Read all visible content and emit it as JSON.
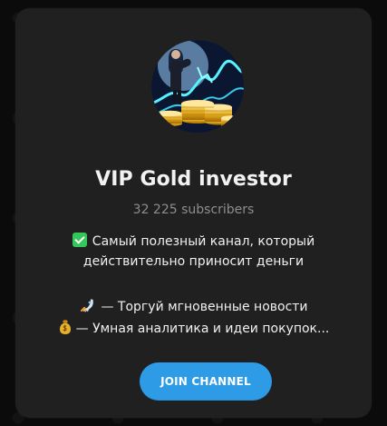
{
  "card": {
    "title": "VIP Gold investor",
    "subscribers": "32 225 subscribers",
    "description": {
      "line1": "Самый полезный канал, который",
      "line2": "действительно приносит деньги",
      "line3": "— Торгуй мгновенные новости",
      "line4": "— Умная аналитика и идеи покупок..."
    },
    "join_button": "JOIN CHANNEL"
  },
  "icons": {
    "check": "checkmark-icon",
    "rocket": "rocket-icon",
    "money": "money-bag-icon"
  },
  "colors": {
    "page_background": "#0b0b0b",
    "card_background": "#202020",
    "accent": "#2d9be6",
    "title": "#f2f2f2",
    "muted": "#8d8d8d"
  }
}
